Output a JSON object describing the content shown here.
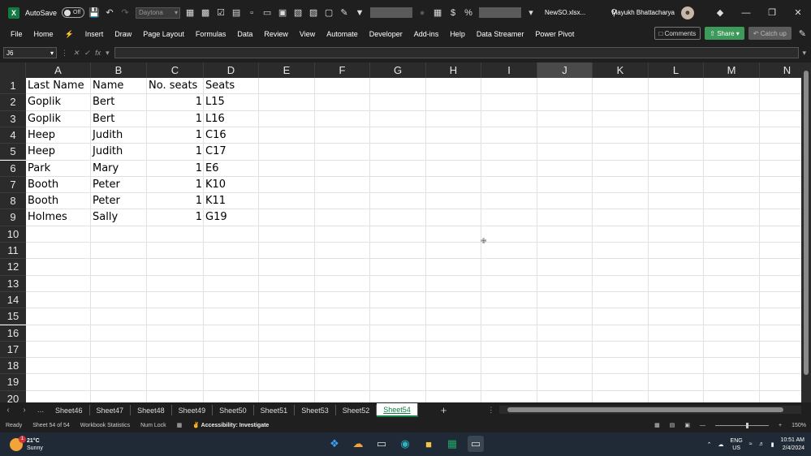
{
  "titlebar": {
    "autosave_label": "AutoSave",
    "autosave_state": "Off",
    "font_name": "Daytona",
    "filename": "NewSO.xlsx...",
    "user_name": "Mayukh Bhattacharya"
  },
  "ribbon": {
    "tabs": [
      "File",
      "Home",
      "Insert",
      "Draw",
      "Page Layout",
      "Formulas",
      "Data",
      "Review",
      "View",
      "Automate",
      "Developer",
      "Add-ins",
      "Help",
      "Data Streamer",
      "Power Pivot"
    ],
    "comments_label": "Comments",
    "share_label": "Share",
    "catchup_label": "Catch up"
  },
  "formula_bar": {
    "name_box": "J6",
    "fx_label": "fx",
    "formula": ""
  },
  "grid": {
    "columns": [
      "A",
      "B",
      "C",
      "D",
      "E",
      "F",
      "G",
      "H",
      "I",
      "J",
      "K",
      "L",
      "M",
      "N"
    ],
    "selected_column": "J",
    "rows": [
      "1",
      "2",
      "3",
      "4",
      "5",
      "6",
      "7",
      "8",
      "9",
      "10",
      "11",
      "12",
      "13",
      "14",
      "15",
      "16",
      "17",
      "18",
      "19",
      "20"
    ],
    "data": [
      [
        "Last Name",
        "Name",
        "No. seats",
        "Seats"
      ],
      [
        "Goplik",
        "Bert",
        "1",
        "L15"
      ],
      [
        "Goplik",
        "Bert",
        "1",
        "L16"
      ],
      [
        "Heep",
        "Judith",
        "1",
        "C16"
      ],
      [
        "Heep",
        "Judith",
        "1",
        "C17"
      ],
      [
        "Park",
        "Mary",
        "1",
        "E6"
      ],
      [
        "Booth",
        "Peter",
        "1",
        "K10"
      ],
      [
        "Booth",
        "Peter",
        "1",
        "K11"
      ],
      [
        "Holmes",
        "Sally",
        "1",
        "G19"
      ]
    ]
  },
  "sheets": {
    "ellipsis": "...",
    "tabs": [
      "Sheet46",
      "Sheet47",
      "Sheet48",
      "Sheet49",
      "Sheet50",
      "Sheet51",
      "Sheet53",
      "Sheet52",
      "Sheet54"
    ],
    "active": "Sheet54"
  },
  "status": {
    "ready": "Ready",
    "sheet_pos": "Sheet 54 of 54",
    "stats": "Workbook Statistics",
    "numlock": "Num Lock",
    "accessibility": "Accessibility: Investigate",
    "zoom": "150%"
  },
  "taskbar": {
    "temperature": "21°C",
    "weather": "Sunny",
    "badge": "1",
    "lang": "ENG",
    "region": "US",
    "time": "10:51 AM",
    "date": "2/4/2024"
  }
}
